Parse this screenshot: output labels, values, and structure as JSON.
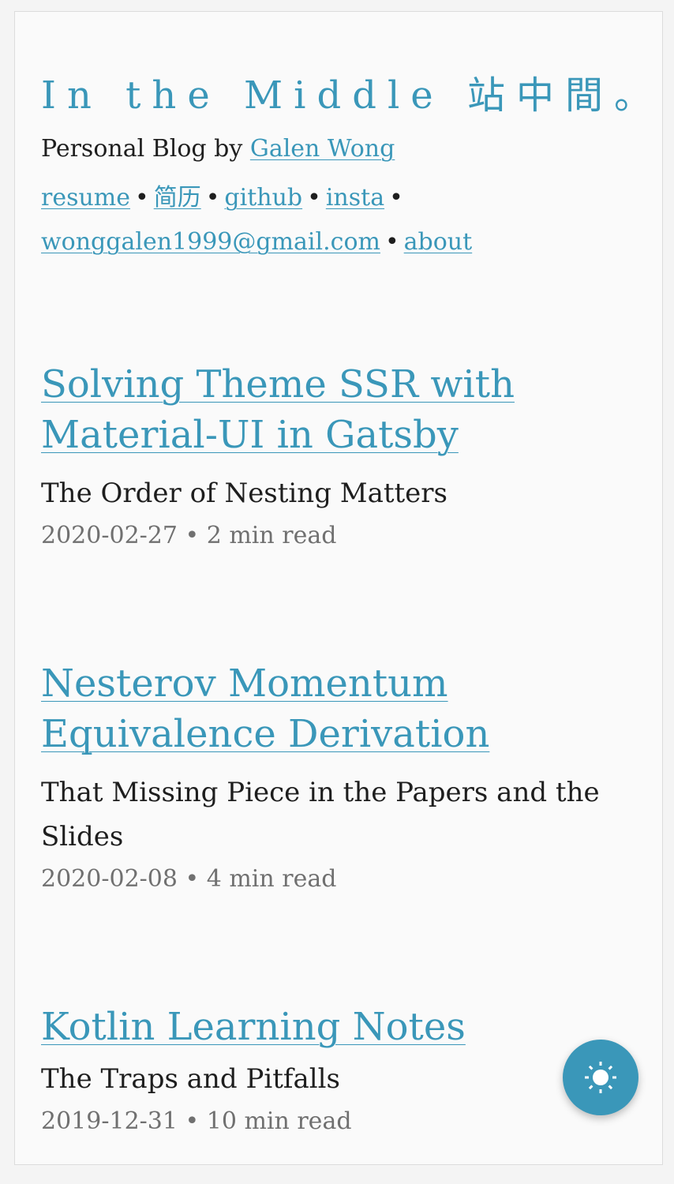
{
  "header": {
    "title": "In the Middle 站中間。",
    "byline_prefix": "Personal Blog by ",
    "author": "Galen Wong",
    "links": {
      "resume": "resume",
      "resume_cn": "简历",
      "github": "github",
      "insta": "insta",
      "email": "wonggalen1999@gmail.com",
      "about": "about"
    },
    "separator": "•"
  },
  "posts": [
    {
      "title": "Solving Theme SSR with Material-UI in Gatsby",
      "subtitle": "The Order of Nesting Matters",
      "meta": "2020-02-27 • 2 min read"
    },
    {
      "title": "Nesterov Momentum Equivalence Derivation",
      "subtitle": "That Missing Piece in the Papers and the Slides",
      "meta": "2020-02-08 • 4 min read"
    },
    {
      "title": "Kotlin Learning Notes",
      "subtitle": "The Traps and Pitfalls",
      "meta": "2019-12-31 • 10 min read"
    }
  ],
  "theme_toggle": {
    "icon": "sun-icon"
  },
  "colors": {
    "accent": "#3a97b9",
    "text": "#1e1e1e",
    "muted": "#707070",
    "background": "#fafafa"
  }
}
